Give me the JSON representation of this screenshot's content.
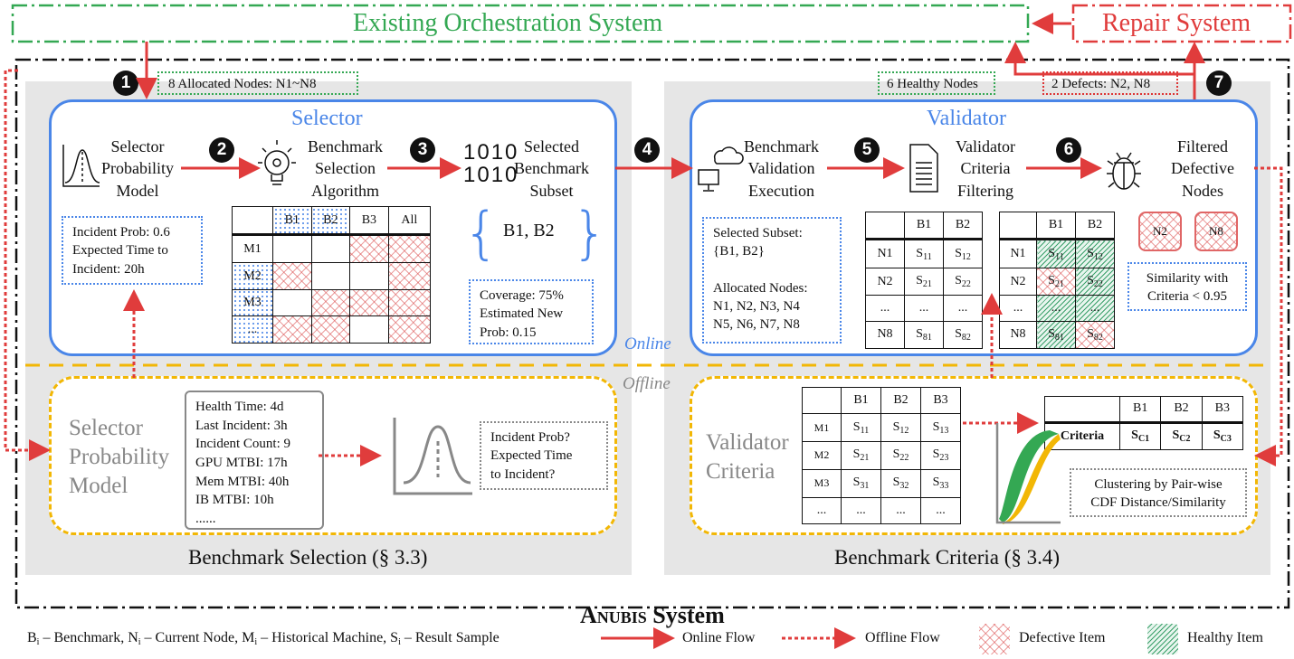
{
  "top": {
    "orchestration_title": "Existing Orchestration System",
    "repair_title": "Repair System"
  },
  "anubis": {
    "title_prefix": "Anubis",
    "title_suffix": " System"
  },
  "steps": [
    "1",
    "2",
    "3",
    "4",
    "5",
    "6",
    "7"
  ],
  "tags": {
    "allocated_nodes": "8 Allocated Nodes: N1~N8",
    "healthy_nodes": "6 Healthy Nodes",
    "defects": "2 Defects: N2, N8"
  },
  "selector": {
    "title": "Selector",
    "prob_model": "Selector\nProbability\nModel",
    "algorithm": "Benchmark\nSelection\nAlgorithm",
    "subset": "Selected\nBenchmark\nSubset",
    "binary_icon_text": "1010\n1010",
    "incident_note": "Incident Prob: 0.6\nExpected Time to\nIncident: 20h",
    "subset_value": "B1, B2",
    "coverage_note": "Coverage: 75%\nEstimated New\nProb: 0.15",
    "matrix": {
      "header": [
        "",
        "B1",
        "B2",
        "B3",
        "All"
      ],
      "rows": [
        {
          "label": "M1",
          "cells": [
            "none",
            "none",
            "defective",
            "defective"
          ]
        },
        {
          "label": "M2",
          "cells": [
            "defective",
            "none",
            "none",
            "defective"
          ]
        },
        {
          "label": "M3",
          "cells": [
            "none",
            "defective",
            "defective",
            "defective"
          ]
        },
        {
          "label": "...",
          "cells": [
            "defective",
            "defective",
            "none",
            "defective"
          ]
        }
      ]
    }
  },
  "validator": {
    "title": "Validator",
    "execution": "Benchmark\nValidation\nExecution",
    "filtering": "Validator\nCriteria\nFiltering",
    "filtered": "Filtered\nDefective\nNodes",
    "subset_note": "Selected Subset:\n{B1, B2}\n\nAllocated Nodes:\nN1, N2, N3, N4\nN5, N6, N7, N8",
    "results_table": {
      "header": [
        "",
        "B1",
        "B2"
      ],
      "rows": [
        [
          "N1",
          "S",
          "11",
          "S",
          "12"
        ],
        [
          "N2",
          "S",
          "21",
          "S",
          "22"
        ],
        [
          "...",
          "...",
          "",
          "...",
          ""
        ],
        [
          "N8",
          "S",
          "81",
          "S",
          "82"
        ]
      ]
    },
    "filtered_table_status": [
      [
        "healthy",
        "healthy"
      ],
      [
        "defective",
        "healthy"
      ],
      [
        "healthy",
        "healthy"
      ],
      [
        "healthy",
        "defective"
      ]
    ],
    "defective_nodes": [
      "N2",
      "N8"
    ],
    "similarity_note": "Similarity with\nCriteria < 0.95"
  },
  "phase_labels": {
    "online": "Online",
    "offline": "Offline"
  },
  "offline_selection": {
    "title": "Selector\nProbability\nModel",
    "features": "Health Time: 4d\nLast Incident: 3h\nIncident Count: 9\nGPU MTBI: 17h\nMem MTBI: 40h\nIB MTBI: 10h\n......",
    "question_note": "Incident Prob?\nExpected Time\nto Incident?",
    "section_label": "Benchmark Selection (§ 3.3)"
  },
  "offline_criteria": {
    "title": "Validator\nCriteria",
    "history_table": {
      "header": [
        "",
        "B1",
        "B2",
        "B3"
      ],
      "rows": [
        [
          "M1",
          "11",
          "12",
          "13"
        ],
        [
          "M2",
          "21",
          "22",
          "23"
        ],
        [
          "M3",
          "31",
          "32",
          "33"
        ],
        [
          "...",
          "",
          "",
          ""
        ]
      ]
    },
    "criteria_table": {
      "header": [
        "",
        "B1",
        "B2",
        "B3"
      ],
      "row_label": "Criteria",
      "cells": [
        "C1",
        "C2",
        "C3"
      ]
    },
    "clustering_note": "Clustering by Pair-wise\nCDF Distance/Similarity",
    "section_label": "Benchmark Criteria (§ 3.4)"
  },
  "legend": {
    "definitions": [
      {
        "sym": "B",
        "desc": " – Benchmark, "
      },
      {
        "sym": "N",
        "desc": " – Current Node, "
      },
      {
        "sym": "M",
        "desc": " – Historical Machine, "
      },
      {
        "sym": "S",
        "desc": " – Result Sample"
      }
    ],
    "subscript": "i",
    "online_flow": "Online Flow",
    "offline_flow": "Offline Flow",
    "defective_item": "Defective Item",
    "healthy_item": "Healthy Item"
  },
  "colors": {
    "online_blue": "#4a86e8",
    "offline_yellow": "#f2b705",
    "flow_red": "#e03c3c",
    "orchestration_green": "#34a853",
    "repair_red": "#e03c3c"
  }
}
